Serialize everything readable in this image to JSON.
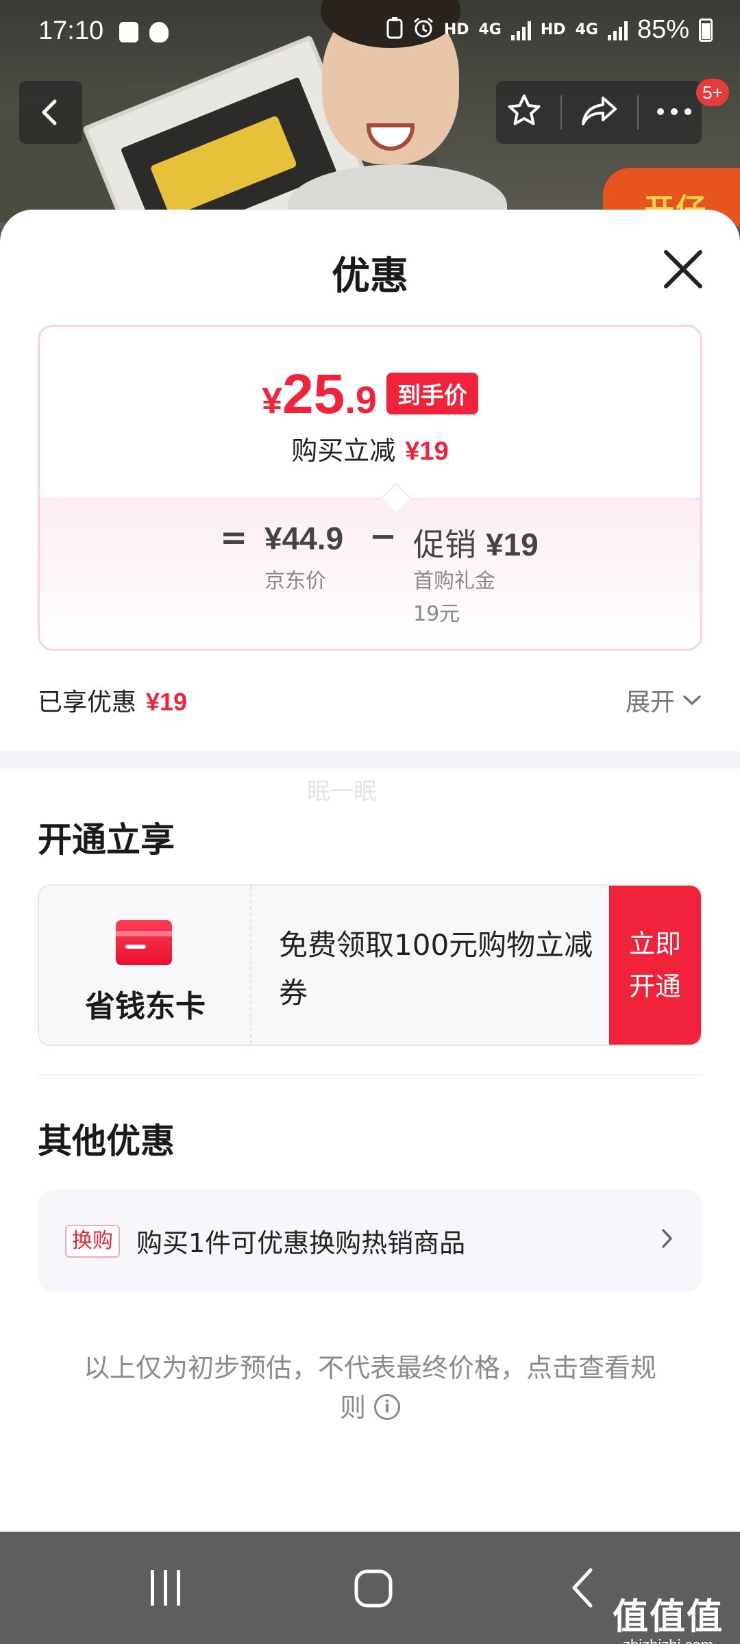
{
  "status_bar": {
    "time": "17:10",
    "net1": "HD",
    "net1_gen": "4G",
    "net2": "HD",
    "net2_gen": "4G",
    "battery": "85%"
  },
  "nav": {
    "badge": "5+",
    "icons": [
      "back-icon",
      "star-icon",
      "share-icon",
      "more-icon"
    ]
  },
  "background": {
    "promo_text": "开仔"
  },
  "sheet": {
    "title": "优惠",
    "price_card": {
      "currency": "¥",
      "price_int": "25",
      "price_dec": ".9",
      "price_tag": "到手价",
      "reduce_label": "购买立减",
      "reduce_value": "¥19",
      "equals": "=",
      "base_price": "¥44.9",
      "base_label": "京东价",
      "minus": "−",
      "promo_label": "促销",
      "promo_value": "¥19",
      "promo_sub1": "首购礼金",
      "promo_sub2": "19元"
    },
    "enjoyed": {
      "label": "已享优惠",
      "value": "¥19",
      "expand": "展开"
    },
    "watermark": "眠一眠",
    "open_section": {
      "title": "开通立享",
      "card_name": "省钱东卡",
      "card_desc": "免费领取100元购物立减券",
      "button": "立即开通"
    },
    "other_section": {
      "title": "其他优惠",
      "tag": "换购",
      "text": "购买1件可优惠换购热销商品"
    },
    "note": "以上仅为初步预估，不代表最终价格，点击查看规则"
  },
  "system_nav": {
    "buttons": [
      "recents-button",
      "home-button",
      "back-button"
    ]
  },
  "brand": {
    "name": "值值值",
    "domain": "zhizhizhi.com"
  },
  "colors": {
    "accent_red": "#f0233a",
    "nav_bar": "#5e5e5e"
  }
}
